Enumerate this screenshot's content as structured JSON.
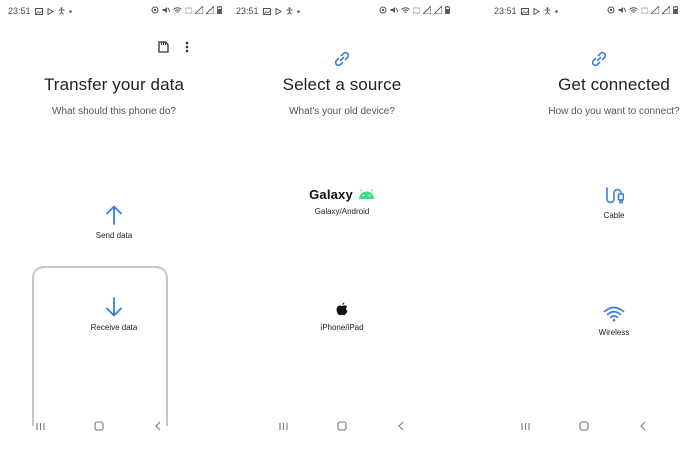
{
  "screens": [
    {
      "status": {
        "time": "23:51"
      },
      "title": "Transfer your data",
      "subtitle": "What should this phone do?",
      "options": [
        {
          "label": "Send data",
          "icon": "arrow-up-icon"
        },
        {
          "label": "Receive data",
          "icon": "arrow-down-icon"
        }
      ],
      "top_icons": [
        "sd-card-icon",
        "more-vert-icon"
      ]
    },
    {
      "status": {
        "time": "23:51"
      },
      "header_icon": "link-icon",
      "title": "Select a source",
      "subtitle": "What's your old device?",
      "options": [
        {
          "label": "Galaxy/Android",
          "logo_text": "Galaxy",
          "icon": "android-icon"
        },
        {
          "label": "iPhone/iPad",
          "icon": "apple-icon"
        }
      ]
    },
    {
      "status": {
        "time": "23:51"
      },
      "header_icon": "link-icon",
      "title": "Get connected",
      "subtitle": "How do you want to connect?",
      "options": [
        {
          "label": "Cable",
          "icon": "cable-icon"
        },
        {
          "label": "Wireless",
          "icon": "wifi-icon"
        }
      ]
    }
  ],
  "colors": {
    "accent": "#3b7ddd",
    "android_green": "#3ddc84",
    "text": "#222222",
    "subtext": "#555555",
    "card_border": "#c5c5c5"
  }
}
